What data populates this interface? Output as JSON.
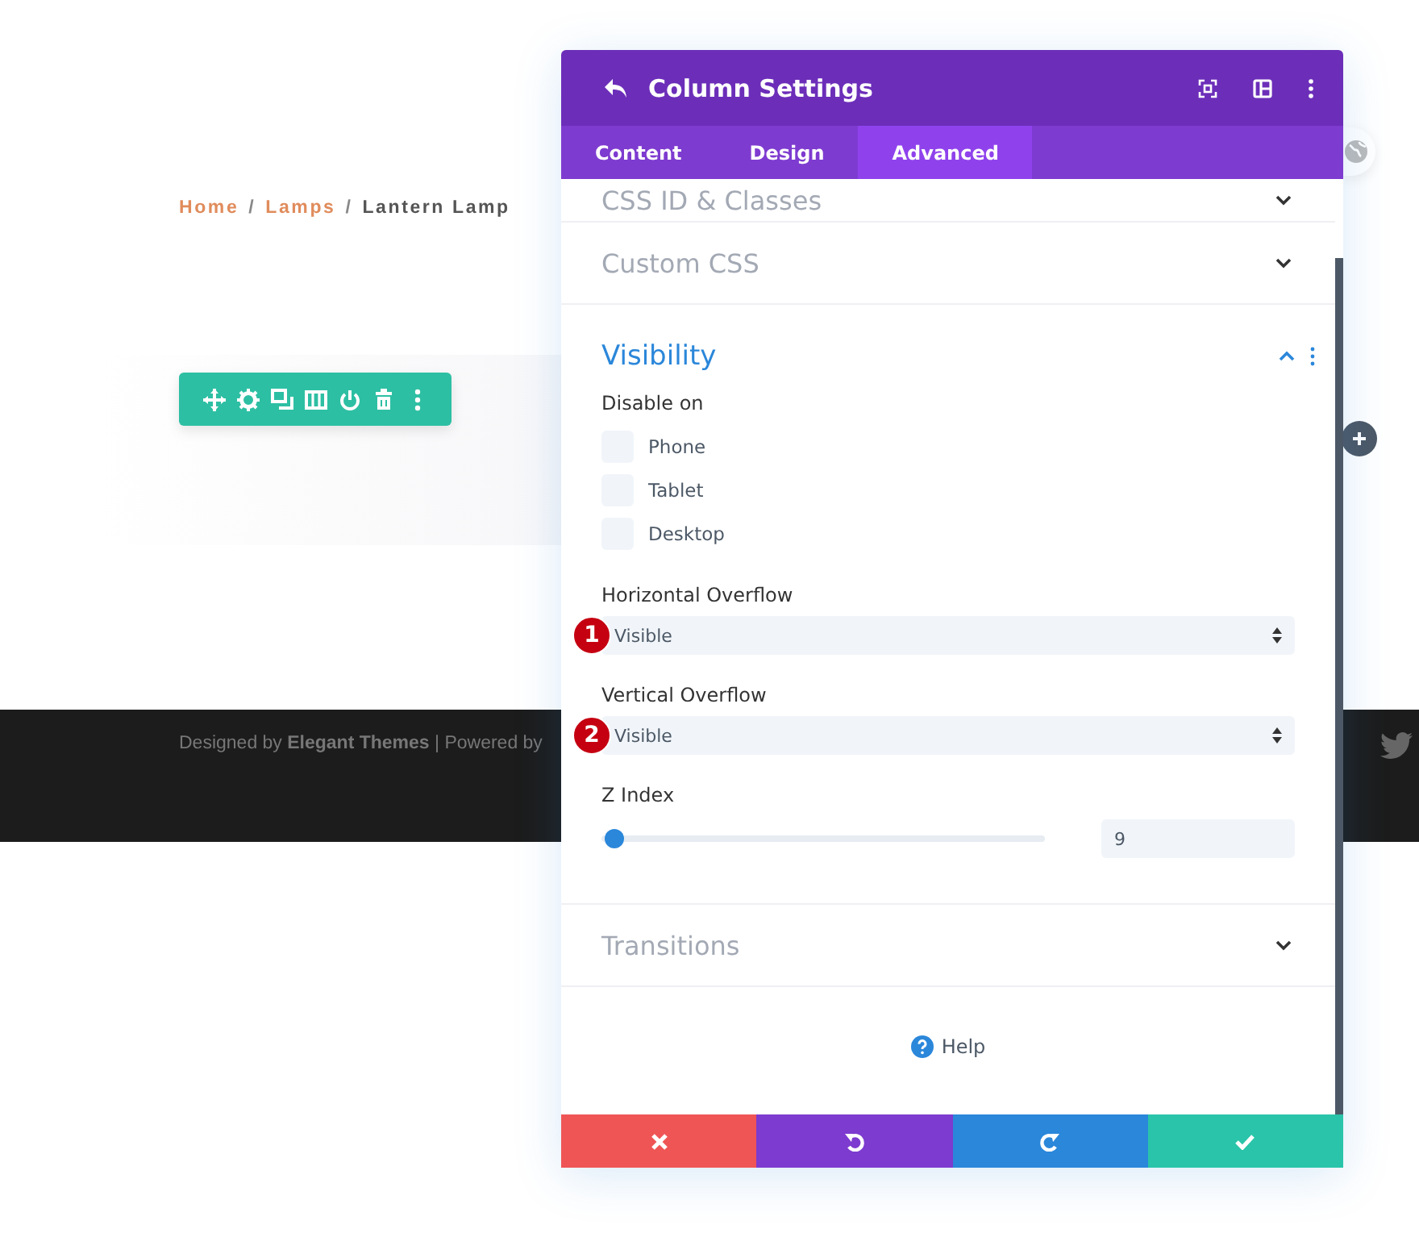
{
  "breadcrumb": [
    {
      "label": "Home",
      "kind": "link"
    },
    {
      "label": "/",
      "kind": "separator"
    },
    {
      "label": "Lamps",
      "kind": "link"
    },
    {
      "label": "/",
      "kind": "separator"
    },
    {
      "label": "Lantern Lamp",
      "kind": "current"
    }
  ],
  "footer": {
    "credit": "Designed by **Elegant Themes** | Powered by"
  },
  "modal": {
    "title": "Column Settings",
    "tabs": [
      {
        "label": "Content",
        "selected": false
      },
      {
        "label": "Design",
        "selected": false
      },
      {
        "label": "Advanced",
        "selected": true
      }
    ],
    "sections": [
      {
        "title": "CSS ID & Classes",
        "expanded": false
      },
      {
        "title": "Custom CSS",
        "expanded": false
      },
      {
        "title": "Visibility",
        "expanded": true
      },
      {
        "title": "Transitions",
        "expanded": false
      }
    ],
    "visibility": {
      "disable_label": "Disable on",
      "options": [
        {
          "label": "Phone",
          "checked": false
        },
        {
          "label": "Tablet",
          "checked": false
        },
        {
          "label": "Desktop",
          "checked": false
        }
      ],
      "selects": [
        {
          "label": "Horizontal Overflow",
          "value": "Visible",
          "badge": "1"
        },
        {
          "label": "Vertical Overflow",
          "value": "Visible",
          "badge": "2"
        }
      ],
      "z_index": {
        "label": "Z Index",
        "level": 0,
        "value": "9"
      }
    },
    "help": "Help"
  }
}
